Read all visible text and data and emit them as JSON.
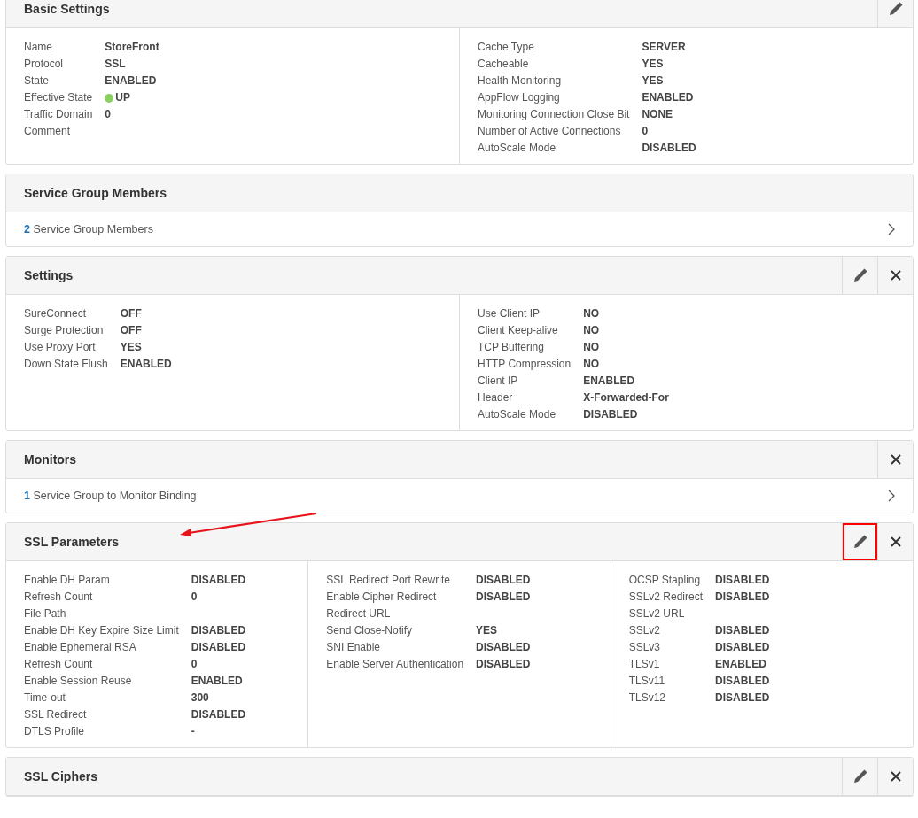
{
  "panels": [
    {
      "kind": "fields",
      "title": "Basic Settings",
      "actions": [
        {
          "kind": "edit",
          "highlighted": false
        }
      ],
      "columns": [
        [
          {
            "label": "Name",
            "value": "StoreFront"
          },
          {
            "label": "Protocol",
            "value": "SSL"
          },
          {
            "label": "State",
            "value": "ENABLED"
          },
          {
            "label": "Effective State",
            "value": "UP",
            "color": "#8ccf62"
          },
          {
            "label": "Traffic Domain",
            "value": "0"
          },
          {
            "label": "Comment"
          }
        ],
        [
          {
            "label": "Cache Type",
            "value": "SERVER"
          },
          {
            "label": "Cacheable",
            "value": "YES"
          },
          {
            "label": "Health Monitoring",
            "value": "YES"
          },
          {
            "label": "AppFlow Logging",
            "value": "ENABLED"
          },
          {
            "label": "Monitoring Connection Close Bit",
            "value": "NONE"
          },
          {
            "label": "Number of Active Connections",
            "value": "0"
          },
          {
            "label": "AutoScale Mode",
            "value": "DISABLED"
          }
        ]
      ]
    },
    {
      "kind": "link",
      "title": "Service Group Members",
      "link": {
        "count": "2",
        "text": "Service Group Members"
      }
    },
    {
      "kind": "fields",
      "title": "Settings",
      "actions": [
        {
          "kind": "edit",
          "highlighted": false
        },
        {
          "kind": "close",
          "highlighted": false
        }
      ],
      "columns": [
        [
          {
            "label": "SureConnect",
            "value": "OFF"
          },
          {
            "label": "Surge Protection",
            "value": "OFF"
          },
          {
            "label": "Use Proxy Port",
            "value": "YES"
          },
          {
            "label": "Down State Flush",
            "value": "ENABLED"
          }
        ],
        [
          {
            "label": "Use Client IP",
            "value": "NO"
          },
          {
            "label": "Client Keep-alive",
            "value": "NO"
          },
          {
            "label": "TCP Buffering",
            "value": "NO"
          },
          {
            "label": "HTTP Compression",
            "value": "NO"
          },
          {
            "label": "Client IP",
            "value": "ENABLED"
          },
          {
            "label": "Header",
            "value": "X-Forwarded-For"
          },
          {
            "label": "AutoScale Mode",
            "value": "DISABLED"
          }
        ]
      ]
    },
    {
      "kind": "link",
      "title": "Monitors",
      "actions": [
        {
          "kind": "close",
          "highlighted": false
        }
      ],
      "link": {
        "count": "1",
        "text": "Service Group to Monitor Binding"
      }
    },
    {
      "kind": "fields",
      "title": "SSL Parameters",
      "arrow": true,
      "actions": [
        {
          "kind": "edit",
          "highlighted": true
        },
        {
          "kind": "close",
          "highlighted": false
        }
      ],
      "columns": [
        [
          {
            "label": "Enable DH Param",
            "value": "DISABLED"
          },
          {
            "label": "Refresh Count",
            "value": "0"
          },
          {
            "label": "File Path"
          },
          {
            "label": "Enable DH Key Expire Size Limit",
            "value": "DISABLED"
          },
          {
            "label": "Enable Ephemeral RSA",
            "value": "DISABLED"
          },
          {
            "label": "Refresh Count",
            "value": "0"
          },
          {
            "label": "Enable Session Reuse",
            "value": "ENABLED"
          },
          {
            "label": "Time-out",
            "value": "300"
          },
          {
            "label": "SSL Redirect",
            "value": "DISABLED"
          },
          {
            "label": "DTLS Profile",
            "value": "-"
          }
        ],
        [
          {
            "label": "SSL Redirect Port Rewrite",
            "value": "DISABLED"
          },
          {
            "label": "Enable Cipher Redirect",
            "value": "DISABLED"
          },
          {
            "label": "Redirect URL"
          },
          {
            "label": "Send Close-Notify",
            "value": "YES"
          },
          {
            "label": "SNI Enable",
            "value": "DISABLED"
          },
          {
            "label": "Enable Server Authentication",
            "value": "DISABLED"
          }
        ],
        [
          {
            "label": "OCSP Stapling",
            "value": "DISABLED"
          },
          {
            "label": "SSLv2 Redirect",
            "value": "DISABLED"
          },
          {
            "label": "SSLv2 URL"
          },
          {
            "label": "SSLv2",
            "value": "DISABLED"
          },
          {
            "label": "SSLv3",
            "value": "DISABLED"
          },
          {
            "label": "TLSv1",
            "value": "ENABLED"
          },
          {
            "label": "TLSv11",
            "value": "DISABLED"
          },
          {
            "label": "TLSv12",
            "value": "DISABLED"
          }
        ]
      ]
    },
    {
      "kind": "header",
      "title": "SSL Ciphers",
      "actions": [
        {
          "kind": "edit",
          "highlighted": false
        },
        {
          "kind": "close",
          "highlighted": false
        }
      ]
    }
  ]
}
